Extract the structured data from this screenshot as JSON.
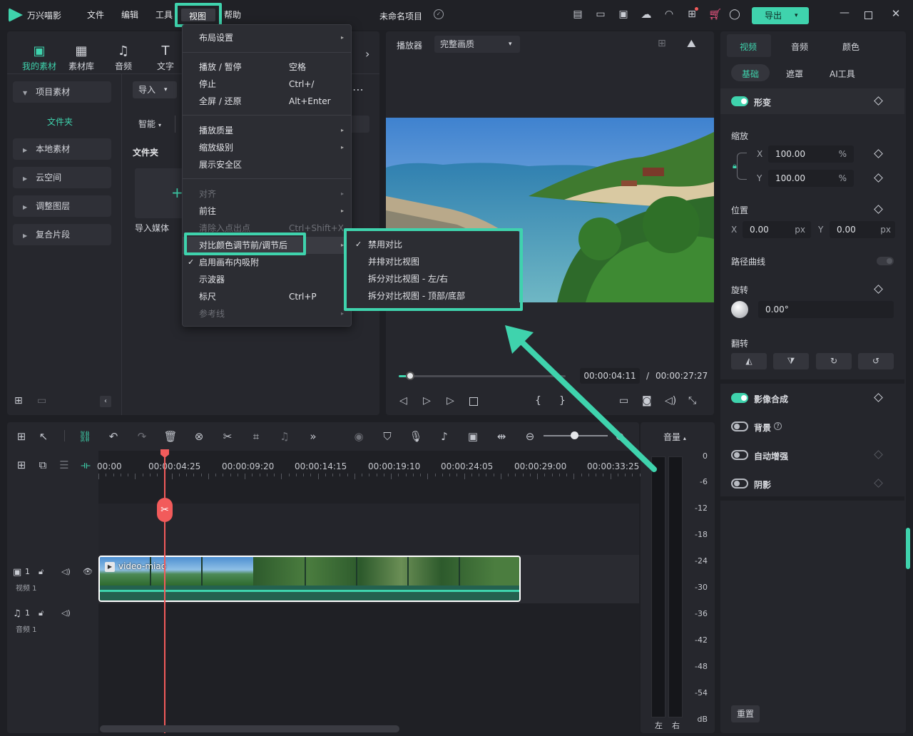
{
  "app": {
    "name": "万兴喵影",
    "project_title": "未命名项目"
  },
  "menubar": [
    "文件",
    "编辑",
    "工具",
    "视图",
    "帮助"
  ],
  "export_label": "导出",
  "left_panel": {
    "tabs": [
      "我的素材",
      "素材库",
      "音频",
      "文字"
    ],
    "sidebar": {
      "project": "项目素材",
      "folder": "文件夹",
      "local": "本地素材",
      "cloud": "云空间",
      "adjust": "调整图层",
      "compound": "复合片段"
    },
    "import_label": "导入",
    "smart_label": "智能",
    "folder_heading": "文件夹",
    "import_media": "导入媒体"
  },
  "view_menu": {
    "layout": "布局设置",
    "play_pause": {
      "label": "播放 / 暂停",
      "shortcut": "空格"
    },
    "stop": {
      "label": "停止",
      "shortcut": "Ctrl+/"
    },
    "fullscreen": {
      "label": "全屏 / 还原",
      "shortcut": "Alt+Enter"
    },
    "quality": "播放质量",
    "zoom": "缩放级别",
    "safe_area": "展示安全区",
    "align": "对齐",
    "goto": "前往",
    "clear_inout": {
      "label": "清除入点出点",
      "shortcut": "Ctrl+Shift+X"
    },
    "compare": "对比颜色调节前/调节后",
    "snap": "启用画布内吸附",
    "scope": "示波器",
    "ruler": {
      "label": "标尺",
      "shortcut": "Ctrl+P"
    },
    "guides": "参考线"
  },
  "compare_submenu": [
    "禁用对比",
    "并排对比视图",
    "拆分对比视图 - 左/右",
    "拆分对比视图 - 顶部/底部"
  ],
  "player": {
    "label": "播放器",
    "quality": "完整画质",
    "current_time": "00:00:04:11",
    "separator": "/",
    "total_time": "00:00:27:27",
    "progress": 0.07
  },
  "timeline": {
    "ruler_times": [
      "00:00",
      "00:00:04:25",
      "00:00:09:20",
      "00:00:14:15",
      "00:00:19:10",
      "00:00:24:05",
      "00:00:29:00",
      "00:00:33:25"
    ],
    "video_track": {
      "num": "1",
      "name": "视频 1"
    },
    "audio_track": {
      "num": "1",
      "name": "音频 1"
    },
    "clip_name": "video-miao"
  },
  "volume": {
    "label": "音量",
    "scale": [
      "0",
      "-6",
      "-12",
      "-18",
      "-24",
      "-30",
      "-36",
      "-42",
      "-48",
      "-54",
      "dB"
    ],
    "left": "左",
    "right": "右"
  },
  "right_panel": {
    "tabs": [
      "视频",
      "音频",
      "颜色"
    ],
    "subtabs": [
      "基础",
      "遮罩",
      "AI工具"
    ],
    "transform": "形变",
    "scale_label": "缩放",
    "scale_x": {
      "axis": "X",
      "value": "100.00",
      "unit": "%"
    },
    "scale_y": {
      "axis": "Y",
      "value": "100.00",
      "unit": "%"
    },
    "position_label": "位置",
    "pos_x": {
      "axis": "X",
      "value": "0.00",
      "unit": "px"
    },
    "pos_y": {
      "axis": "Y",
      "value": "0.00",
      "unit": "px"
    },
    "path_curve": "路径曲线",
    "rotate_label": "旋转",
    "rotate_value": "0.00°",
    "flip_label": "翻转",
    "composite": "影像合成",
    "background": "背景",
    "auto_enhance": "自动增强",
    "shadow": "阴影",
    "reset": "重置"
  },
  "colors": {
    "accent": "#3fd3ad",
    "playhead": "#f25b5b"
  }
}
